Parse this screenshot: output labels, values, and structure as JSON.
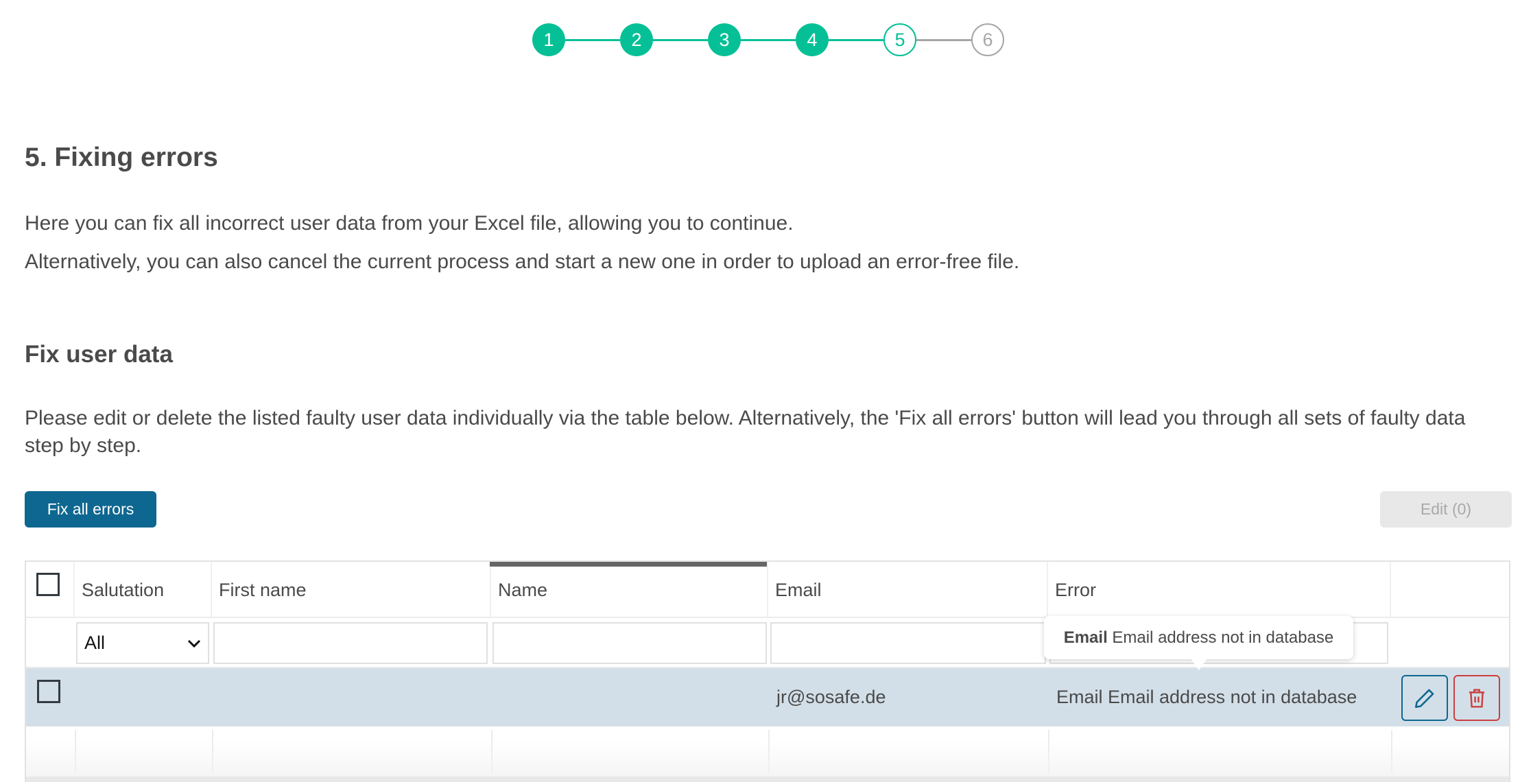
{
  "stepper": {
    "steps": [
      {
        "label": "1",
        "state": "done"
      },
      {
        "label": "2",
        "state": "done"
      },
      {
        "label": "3",
        "state": "done"
      },
      {
        "label": "4",
        "state": "done"
      },
      {
        "label": "5",
        "state": "current"
      },
      {
        "label": "6",
        "state": "todo"
      }
    ],
    "colors": {
      "done": "#05c096",
      "todo": "#a6a6a6"
    }
  },
  "page": {
    "title": "5. Fixing errors",
    "intro_line1": "Here you can fix all incorrect user data from your Excel file, allowing you to continue.",
    "intro_line2": "Alternatively, you can also cancel the current process and start a new one in order to upload an error-free file."
  },
  "section": {
    "title": "Fix user data",
    "description": "Please edit or delete the listed faulty user data individually via the table below. Alternatively, the 'Fix all errors' button will lead you through all sets of faulty data step by step."
  },
  "toolbar": {
    "fix_all_label": "Fix all errors",
    "edit_label": "Edit (0)",
    "primary_color": "#0e6790"
  },
  "table": {
    "columns": [
      "Salutation",
      "First name",
      "Name",
      "Email",
      "Error"
    ],
    "sorted_column": "Name",
    "filters": {
      "salutation": "All",
      "first_name": "",
      "name": "",
      "email": "",
      "error": ""
    },
    "rows": [
      {
        "salutation": "",
        "first_name": "",
        "name": "",
        "email": "jr@sosafe.de",
        "error": "Email Email address not in database",
        "selected": false
      }
    ],
    "row_highlight_color": "#d3dfe8",
    "delete_color": "#c9403f"
  },
  "tooltip": {
    "field": "Email",
    "message": "Email address not in database"
  }
}
